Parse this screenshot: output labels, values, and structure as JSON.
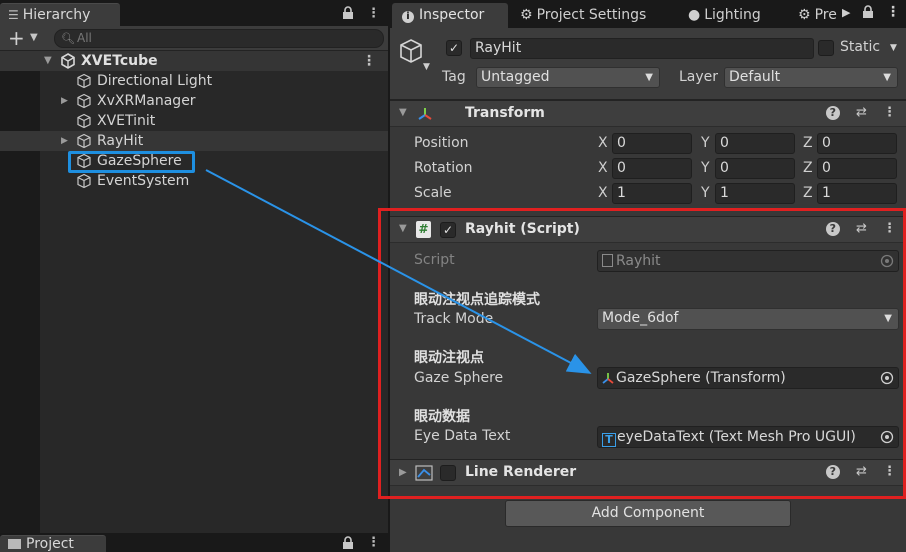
{
  "hierarchy": {
    "tab_label": "Hierarchy",
    "lock_icon": "lock-icon",
    "search_placeholder": "All",
    "scene_name": "XVETcube",
    "items": [
      {
        "label": "Directional Light",
        "expandable": false
      },
      {
        "label": "XvXRManager",
        "expandable": true
      },
      {
        "label": "XVETinit",
        "expandable": false
      },
      {
        "label": "RayHit",
        "expandable": true
      },
      {
        "label": "GazeSphere",
        "expandable": false
      },
      {
        "label": "EventSystem",
        "expandable": false
      }
    ]
  },
  "project_panel": {
    "tab_label": "Project"
  },
  "inspector": {
    "tabs": [
      "Inspector",
      "Project Settings",
      "Lighting",
      "Pre"
    ],
    "object_name": "RayHit",
    "static_label": "Static",
    "tag_label": "Tag",
    "tag_value": "Untagged",
    "layer_label": "Layer",
    "layer_value": "Default",
    "transform": {
      "title": "Transform",
      "position": {
        "label": "Position",
        "x": "0",
        "y": "0",
        "z": "0"
      },
      "rotation": {
        "label": "Rotation",
        "x": "0",
        "y": "0",
        "z": "0"
      },
      "scale": {
        "label": "Scale",
        "x": "1",
        "y": "1",
        "z": "1"
      },
      "axis_x": "X",
      "axis_y": "Y",
      "axis_z": "Z"
    },
    "rayhit": {
      "title": "Rayhit (Script)",
      "script_label": "Script",
      "script_value": "Rayhit",
      "header_track": "眼动注视点追踪模式",
      "track_mode_label": "Track Mode",
      "track_mode_value": "Mode_6dof",
      "header_gaze": "眼动注视点",
      "gaze_label": "Gaze Sphere",
      "gaze_value": "GazeSphere (Transform)",
      "header_eye": "眼动数据",
      "eye_label": "Eye Data Text",
      "eye_value": "eyeDataText (Text Mesh Pro UGUI)"
    },
    "line_renderer": {
      "title": "Line Renderer"
    },
    "add_component": "Add Component"
  },
  "colors": {
    "selection_outline": "#1e8fe0",
    "highlight_box": "#e02020",
    "arrow": "#2a93e8"
  }
}
